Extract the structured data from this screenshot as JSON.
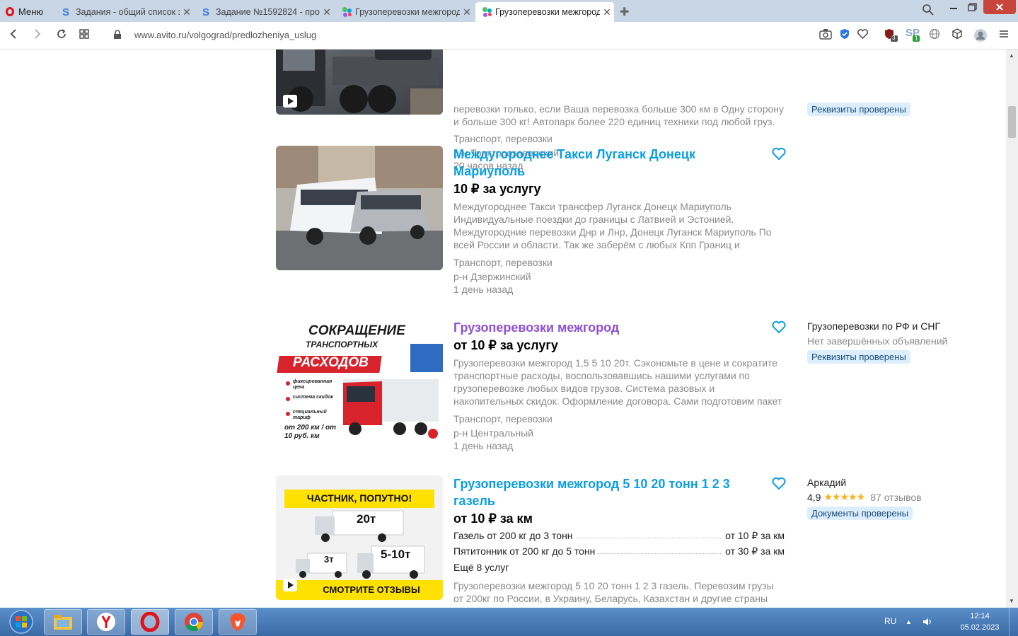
{
  "browser": {
    "menu_label": "Меню",
    "tabs": [
      {
        "title": "Задания - общий список з",
        "icon": "sp-icon"
      },
      {
        "title": "Задание №1592824 - про",
        "icon": "sp-icon"
      },
      {
        "title": "Грузоперевозки межгород",
        "icon": "avito-icon"
      },
      {
        "title": "Грузоперевозки межгород",
        "icon": "avito-icon",
        "active": true
      }
    ],
    "url": "www.avito.ru/volgograd/predlozheniya_uslug",
    "ext_badges": [
      "3",
      "1"
    ]
  },
  "colors": {
    "link": "#0a9ee3",
    "visited": "#8c4fd6",
    "badge_bg": "#dcedfb",
    "star": "#ffb021"
  },
  "listings": [
    {
      "desc": "перевозки только, если Ваша перевозка больше 300 км в Одну сторону и больше 300 кг! Автопарк более 220 единиц техники под любой груз.",
      "category": "Транспорт, перевозки",
      "district": "р-н Тракторозаводский",
      "time": "20 часов назад",
      "badge": "Реквизиты проверены"
    },
    {
      "title": "Междугороднее Такси Луганск Донецк Мариуполь",
      "price": "10 ₽ за услугу",
      "desc": "Междугороднее Такси трансфер Луганск Донецк Мариуполь Индивидуальные поездки до границы с Латвией и Эстонией. Междугородние перевозки Днр и Лнр, Донецк Луганск Мариуполь По всей России и области. Так же заберём с любых Кпп Границ и",
      "category": "Транспорт, перевозки",
      "district": "р-н Дзержинский",
      "time": "1 день назад"
    },
    {
      "title": "Грузоперевозки межгород",
      "price": "от 10 ₽ за услугу",
      "desc": "Грузоперевозки межгород 1,5 5 10 20т. Сэкономьте в цене и сократите транспортные расходы, воспользовавшись нашими услугами по грузоперевозке любых видов грузов. Система разовых и накопительных скидок. Оформление договора. Сами подготовим пакет",
      "category": "Транспорт, перевозки",
      "district": "р-н Центральный",
      "time": "1 день назад",
      "seller": "Грузоперевозки по РФ и СНГ",
      "seller_sub": "Нет завершённых объявлений",
      "badge": "Реквизиты проверены",
      "image_text": {
        "line1": "СОКРАЩЕНИЕ",
        "line2": "ТРАНСПОРТНЫХ",
        "line3": "РАСХОДОВ",
        "b1": "фиксированная цена",
        "b2": "система скидок",
        "b3": "специальный тариф",
        "b4": "от 200 км / от 10 руб. км"
      }
    },
    {
      "title": "Грузоперевозки межгород 5 10 20 тонн 1 2 3 газель",
      "price": "от 10 ₽ за км",
      "services": [
        {
          "name": "Газель от 200 кг до 3 тонн",
          "price": "от 10 ₽ за км"
        },
        {
          "name": "Пятитонник от 200 кг до 5 тонн",
          "price": "от 30 ₽ за км"
        }
      ],
      "more_services": "Ещё 8 услуг",
      "desc": "Грузоперевозки межгород 5 10 20 тонн 1 2 3 газель. Перевозим грузы от 200кг по России, в Украину, Беларусь, Казахстан и другие страны",
      "seller": "Аркадий",
      "rating": "4,9",
      "stars": 5,
      "reviews": "87 отзывов",
      "badge": "Документы проверены",
      "image_text": {
        "top": "ЧАСТНИК, ПОПУТНО!",
        "t1": "20т",
        "t2": "3т",
        "t3": "5-10т",
        "bottom": "СМОТРИТЕ ОТЗЫВЫ"
      }
    }
  ],
  "taskbar": {
    "lang": "RU",
    "time": "12:14",
    "date": "05.02.2023"
  }
}
